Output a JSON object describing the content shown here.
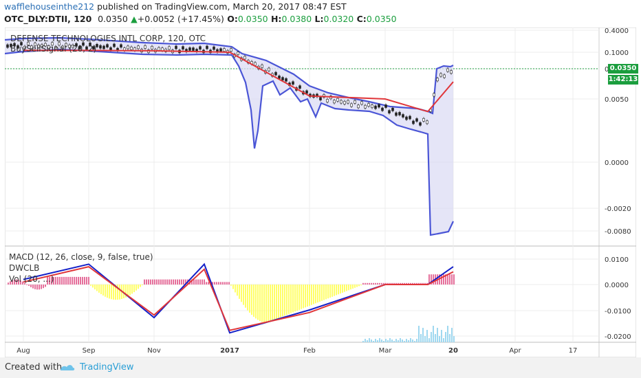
{
  "header": {
    "author": "wafflehouseinthe212",
    "published": "published on TradingView.com, March 20, 2017 08:47 EST",
    "symbol": "OTC_DLY:DTII, 120",
    "last": "0.0350",
    "change_arrow": "▲",
    "change": "+0.0052 (+17.45%)",
    "o_label": "O:",
    "o_value": "0.0350",
    "h_label": "H:",
    "h_value": "0.0380",
    "l_label": "L:",
    "l_value": "0.0320",
    "c_label": "C:",
    "c_value": "0.0350"
  },
  "price_pane": {
    "title": "DEFENSE TECHNOLOGIES INTL CORP, 120, OTC",
    "indicator": "BuySellSignal (20, 2)",
    "last_price_tag": "0.0350",
    "countdown_tag": "1:42:13"
  },
  "macd_pane": {
    "label1": "MACD (12, 26, close, 9, false, true)",
    "label2": "DWCLB",
    "label3": "Vol (20, ...)"
  },
  "footer": {
    "created_with": "Created with",
    "brand": "TradingView"
  },
  "colors": {
    "accent": "#2a9fd6",
    "band": "#4a55d6",
    "ma_red": "#e0363a",
    "macd_blue": "#1420c8",
    "macd_hist_yellow": "#ffff66",
    "macd_hist_pink": "#e56f9b",
    "last_price_green": "#1b9e3e"
  },
  "chart_data": [
    {
      "type": "line",
      "title": "DEFENSE TECHNOLOGIES INTL CORP, 120, OTC",
      "x_ticks": [
        "Aug",
        "Sep",
        "Nov",
        "2017",
        "Feb",
        "Mar",
        "20",
        "Apr",
        "17"
      ],
      "y_ticks": [
        "0.4000",
        "0.1000",
        "0.0350",
        "0.0050",
        "0.0000",
        "-0.0020",
        "-0.0080"
      ],
      "series": [
        {
          "name": "Price",
          "points": [
            [
              "Aug",
              0.12
            ],
            [
              "Sep",
              0.13
            ],
            [
              "Nov",
              0.11
            ],
            [
              "2017",
              0.11
            ],
            [
              "Feb",
              0.007
            ],
            [
              "Mar",
              0.004
            ],
            [
              "Mar 17",
              0.003
            ],
            [
              "20",
              0.035
            ]
          ]
        },
        {
          "name": "Moving average",
          "points": [
            [
              "Aug",
              0.125
            ],
            [
              "Sep",
              0.125
            ],
            [
              "Nov",
              0.12
            ],
            [
              "2017",
              0.1
            ],
            [
              "Feb",
              0.008
            ],
            [
              "Mar",
              0.005
            ],
            [
              "Mar 17",
              0.004
            ],
            [
              "20",
              0.022
            ]
          ]
        }
      ],
      "last_price": 0.035,
      "scale": "non-linear price axis"
    },
    {
      "type": "line",
      "title": "MACD (12, 26, close, 9, false, true)",
      "y_ticks": [
        "0.0100",
        "0.0000",
        "-0.0100",
        "-0.0200"
      ],
      "series": [
        {
          "name": "MACD",
          "points": [
            [
              "Aug",
              0.002
            ],
            [
              "Sep",
              0.008
            ],
            [
              "Nov",
              -0.013
            ],
            [
              "Dec",
              0.008
            ],
            [
              "2017",
              -0.019
            ],
            [
              "Feb",
              -0.01
            ],
            [
              "Mar",
              0.0
            ],
            [
              "Mar 17",
              0.0
            ],
            [
              "20",
              0.007
            ]
          ]
        },
        {
          "name": "Signal",
          "points": [
            [
              "Aug",
              0.001
            ],
            [
              "Sep",
              0.007
            ],
            [
              "Nov",
              -0.012
            ],
            [
              "Dec",
              0.006
            ],
            [
              "2017",
              -0.018
            ],
            [
              "Feb",
              -0.011
            ],
            [
              "Mar",
              0.0
            ],
            [
              "Mar 17",
              0.0
            ],
            [
              "20",
              0.005
            ]
          ]
        }
      ]
    }
  ]
}
